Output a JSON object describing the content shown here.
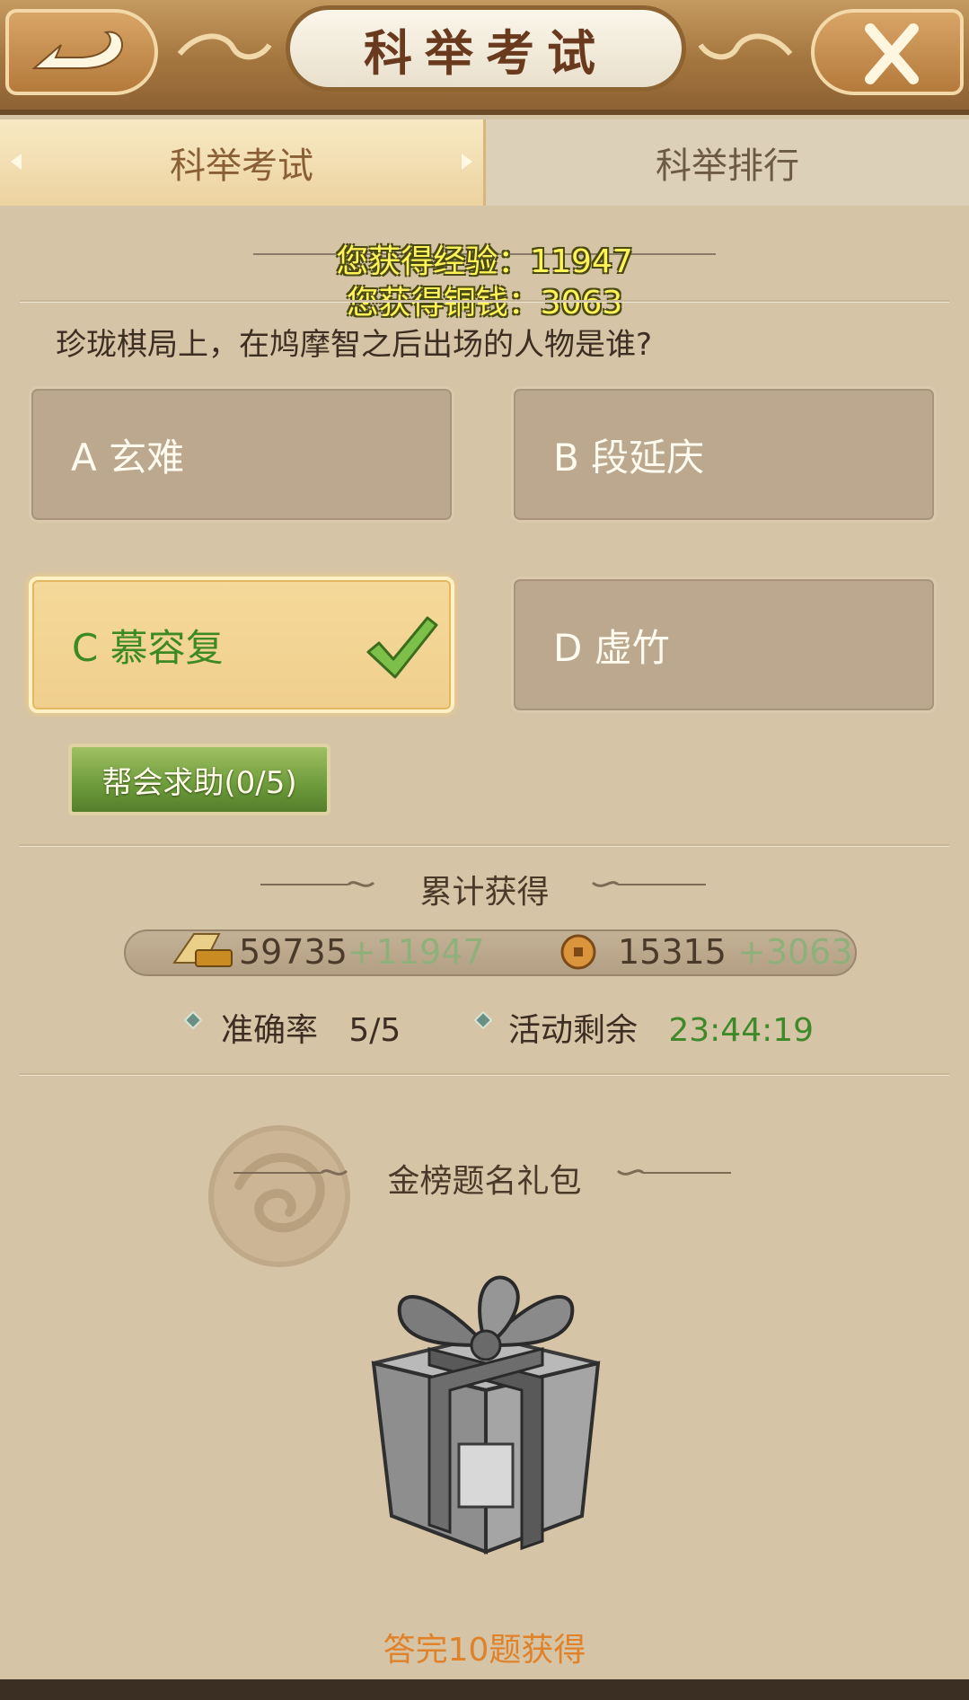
{
  "header": {
    "title": "科举考试",
    "back_icon": "back-arrow-icon",
    "close_icon": "close-x-icon"
  },
  "tabs": [
    {
      "label": "科举考试",
      "active": true
    },
    {
      "label": "科举排行",
      "active": false
    }
  ],
  "rewards_popup": {
    "exp_text": "您获得经验：11947",
    "coin_text": "您获得铜钱：3063"
  },
  "question": {
    "text": "珍珑棋局上，在鸠摩智之后出场的人物是谁?",
    "options": [
      {
        "label": "A 玄难",
        "selected": false
      },
      {
        "label": "B 段延庆",
        "selected": false
      },
      {
        "label": "C 慕容复",
        "selected": true
      },
      {
        "label": "D 虚竹",
        "selected": false
      }
    ]
  },
  "help_button": {
    "label": "帮会求助(0/5)"
  },
  "cumulative": {
    "title": "累计获得",
    "exp_total": "59735",
    "exp_gain": "+11947",
    "coin_total": "15315",
    "coin_gain": "+3063",
    "accuracy_label": "准确率",
    "accuracy_value": "5/5",
    "remaining_label": "活动剩余",
    "remaining_value": "23:44:19"
  },
  "gift": {
    "title": "金榜题名礼包",
    "caption": "答完10题获得",
    "icon": "gift-box-icon"
  },
  "colors": {
    "background": "#d6c4a6",
    "selected_text": "#3d8a25",
    "timer": "#3e8a2b",
    "caption": "#e0822a",
    "floater": "#fff35a"
  }
}
